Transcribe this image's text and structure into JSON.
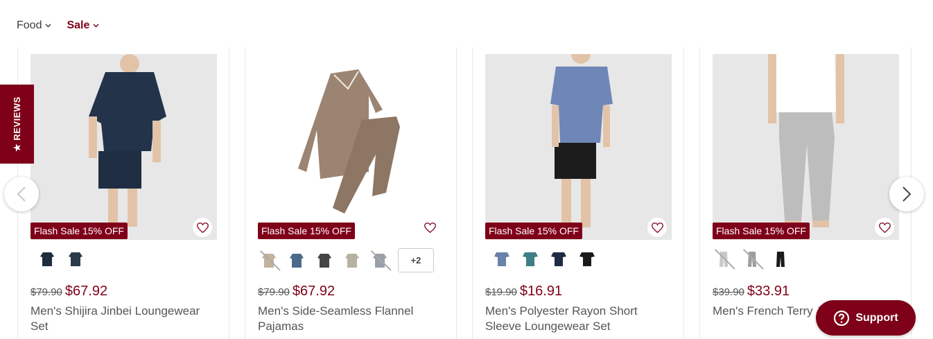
{
  "nav": {
    "items": [
      {
        "label": "Food"
      },
      {
        "label": "Sale"
      }
    ]
  },
  "reviews_tab": {
    "label": "★ REVIEWS"
  },
  "products": [
    {
      "badge": "Flash Sale 15% OFF",
      "old_price": "$79.90",
      "price": "$67.92",
      "name": "Men's Shijira Jinbei Loungewear Set",
      "swatch_colors": [
        "#1f2d3f",
        "#2b3a4a"
      ]
    },
    {
      "badge": "Flash Sale 15% OFF",
      "old_price": "$79.90",
      "price": "$67.92",
      "name": "Men's Side-Seamless Flannel Pajamas",
      "swatch_colors": [
        "#c4b09b",
        "#4a6a8a",
        "#444444",
        "#b8b0a0",
        "#9aa0a8"
      ],
      "more_label": "+2"
    },
    {
      "badge": "Flash Sale 15% OFF",
      "old_price": "$19.90",
      "price": "$16.91",
      "name": "Men's Polyester Rayon Short Sleeve Loungewear Set",
      "swatch_colors": [
        "#6b82a8",
        "#3e7e86",
        "#1e2b44",
        "#1a1a1a"
      ]
    },
    {
      "badge": "Flash Sale 15% OFF",
      "old_price": "$39.90",
      "price": "$33.91",
      "name": "Men's French Terry J",
      "swatch_colors": [
        "#c8c8c8",
        "#9aa0a0",
        "#1a1a1a"
      ]
    }
  ],
  "support": {
    "label": "Support"
  },
  "colors": {
    "brand": "#7f0019"
  }
}
